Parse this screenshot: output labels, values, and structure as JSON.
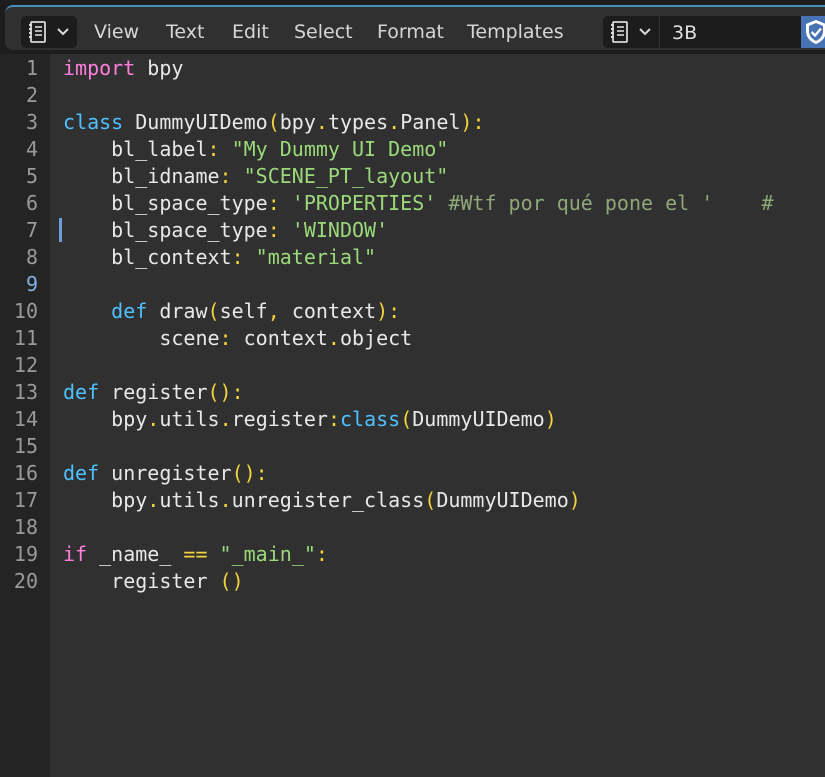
{
  "header": {
    "menu": [
      "View",
      "Text",
      "Edit",
      "Select",
      "Format",
      "Templates"
    ],
    "text_block_name": "3B",
    "editor_type_icon": "text-editor-icon",
    "text_block_icon": "text-datablock-icon",
    "fake_user_icon": "shield-check-icon",
    "accent_color": "#4772b3"
  },
  "editor": {
    "current_line": 9,
    "lines": [
      {
        "n": "1",
        "tokens": [
          {
            "t": "import",
            "c": "kw2"
          },
          {
            "t": " bpy",
            "c": "plain"
          }
        ]
      },
      {
        "n": "2",
        "tokens": []
      },
      {
        "n": "3",
        "tokens": [
          {
            "t": "class",
            "c": "kw"
          },
          {
            "t": " DummyUIDemo",
            "c": "plain"
          },
          {
            "t": "(",
            "c": "punct"
          },
          {
            "t": "bpy",
            "c": "plain"
          },
          {
            "t": ".",
            "c": "punct"
          },
          {
            "t": "types",
            "c": "plain"
          },
          {
            "t": ".",
            "c": "punct"
          },
          {
            "t": "Panel",
            "c": "plain"
          },
          {
            "t": "):",
            "c": "punct"
          }
        ]
      },
      {
        "n": "4",
        "tokens": [
          {
            "t": "    bl_label",
            "c": "plain"
          },
          {
            "t": ":",
            "c": "punct"
          },
          {
            "t": " \"My Dummy UI Demo\"",
            "c": "str"
          }
        ]
      },
      {
        "n": "5",
        "tokens": [
          {
            "t": "    bl_idname",
            "c": "plain"
          },
          {
            "t": ":",
            "c": "punct"
          },
          {
            "t": " \"SCENE_PT_layout\"",
            "c": "str"
          }
        ]
      },
      {
        "n": "6",
        "tokens": [
          {
            "t": "    bl_space_type",
            "c": "plain"
          },
          {
            "t": ":",
            "c": "punct"
          },
          {
            "t": " 'PROPERTIES'",
            "c": "str"
          },
          {
            "t": " #Wtf por qué pone el '    #",
            "c": "comment"
          }
        ]
      },
      {
        "n": "7",
        "tokens": [
          {
            "t": "    bl_space_type",
            "c": "plain"
          },
          {
            "t": ":",
            "c": "punct"
          },
          {
            "t": " 'WINDOW'",
            "c": "str"
          }
        ]
      },
      {
        "n": "8",
        "tokens": [
          {
            "t": "    bl_context",
            "c": "plain"
          },
          {
            "t": ":",
            "c": "punct"
          },
          {
            "t": " \"material\"",
            "c": "str"
          }
        ]
      },
      {
        "n": "9",
        "tokens": []
      },
      {
        "n": "10",
        "tokens": [
          {
            "t": "    def",
            "c": "kw"
          },
          {
            "t": " draw",
            "c": "plain"
          },
          {
            "t": "(",
            "c": "punct"
          },
          {
            "t": "self",
            "c": "plain"
          },
          {
            "t": ",",
            "c": "punct"
          },
          {
            "t": " context",
            "c": "plain"
          },
          {
            "t": "):",
            "c": "punct"
          }
        ]
      },
      {
        "n": "11",
        "tokens": [
          {
            "t": "        scene",
            "c": "plain"
          },
          {
            "t": ":",
            "c": "punct"
          },
          {
            "t": " context",
            "c": "plain"
          },
          {
            "t": ".",
            "c": "punct"
          },
          {
            "t": "object",
            "c": "plain"
          }
        ]
      },
      {
        "n": "12",
        "tokens": []
      },
      {
        "n": "13",
        "tokens": [
          {
            "t": "def",
            "c": "kw"
          },
          {
            "t": " register",
            "c": "plain"
          },
          {
            "t": "():",
            "c": "punct"
          }
        ]
      },
      {
        "n": "14",
        "tokens": [
          {
            "t": "    bpy",
            "c": "plain"
          },
          {
            "t": ".",
            "c": "punct"
          },
          {
            "t": "utils",
            "c": "plain"
          },
          {
            "t": ".",
            "c": "punct"
          },
          {
            "t": "register",
            "c": "plain"
          },
          {
            "t": ":",
            "c": "punct"
          },
          {
            "t": "class",
            "c": "kw"
          },
          {
            "t": "(",
            "c": "punct"
          },
          {
            "t": "DummyUIDemo",
            "c": "plain"
          },
          {
            "t": ")",
            "c": "punct"
          }
        ]
      },
      {
        "n": "15",
        "tokens": []
      },
      {
        "n": "16",
        "tokens": [
          {
            "t": "def",
            "c": "kw"
          },
          {
            "t": " unregister",
            "c": "plain"
          },
          {
            "t": "():",
            "c": "punct"
          }
        ]
      },
      {
        "n": "17",
        "tokens": [
          {
            "t": "    bpy",
            "c": "plain"
          },
          {
            "t": ".",
            "c": "punct"
          },
          {
            "t": "utils",
            "c": "plain"
          },
          {
            "t": ".",
            "c": "punct"
          },
          {
            "t": "unregister_class",
            "c": "plain"
          },
          {
            "t": "(",
            "c": "punct"
          },
          {
            "t": "DummyUIDemo",
            "c": "plain"
          },
          {
            "t": ")",
            "c": "punct"
          }
        ]
      },
      {
        "n": "18",
        "tokens": []
      },
      {
        "n": "19",
        "tokens": [
          {
            "t": "if",
            "c": "kw2"
          },
          {
            "t": " _name_ ",
            "c": "plain"
          },
          {
            "t": "==",
            "c": "punct"
          },
          {
            "t": " \"_main_\"",
            "c": "str"
          },
          {
            "t": ":",
            "c": "punct"
          }
        ]
      },
      {
        "n": "20",
        "tokens": [
          {
            "t": "    register ",
            "c": "plain"
          },
          {
            "t": "()",
            "c": "punct"
          }
        ]
      }
    ]
  }
}
